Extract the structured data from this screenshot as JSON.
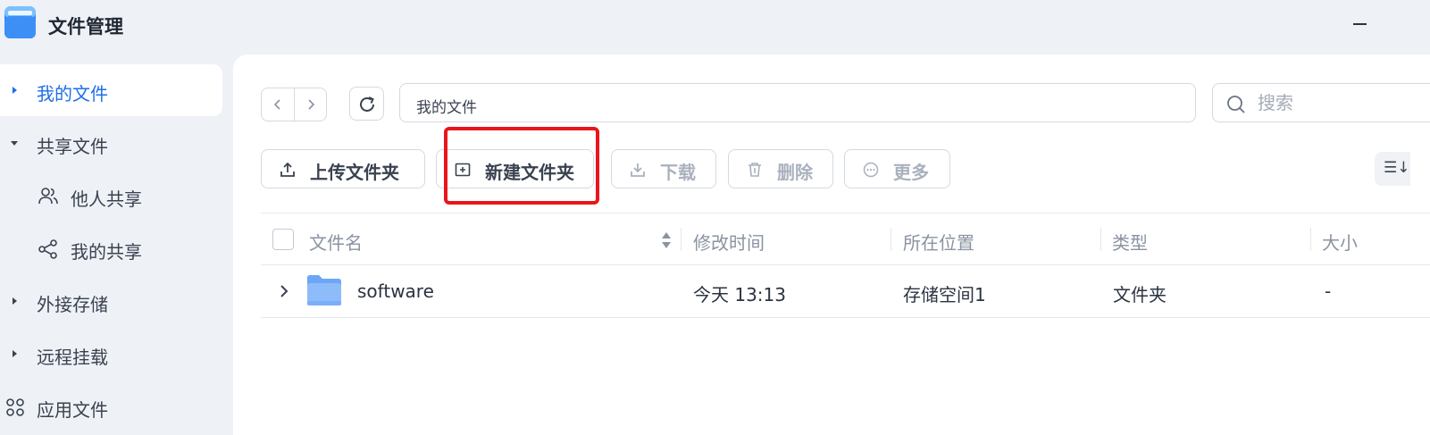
{
  "app": {
    "title": "文件管理",
    "icon": "folder-app-icon",
    "accent_color": "#1e6fe8"
  },
  "sidebar": {
    "items": [
      {
        "label": "我的文件",
        "active": true,
        "expanded": false
      },
      {
        "label": "共享文件",
        "active": false,
        "expanded": true
      },
      {
        "label": "他人共享",
        "icon": "users-icon",
        "sub": true
      },
      {
        "label": "我的共享",
        "icon": "share-icon",
        "sub": true
      },
      {
        "label": "外接存储",
        "active": false,
        "expanded": false
      },
      {
        "label": "远程挂载",
        "active": false,
        "expanded": false
      },
      {
        "label": "应用文件",
        "icon": "apps-grid-icon"
      }
    ]
  },
  "path_bar": {
    "path": "我的文件"
  },
  "search": {
    "placeholder": "搜索"
  },
  "toolbar": {
    "upload_label": "上传文件夹",
    "new_folder_label": "新建文件夹",
    "download_label": "下载",
    "delete_label": "删除",
    "more_label": "更多",
    "highlight_color": "#e8151a"
  },
  "table": {
    "columns": [
      "文件名",
      "修改时间",
      "所在位置",
      "类型",
      "大小"
    ],
    "rows": [
      {
        "name": "software",
        "modified": "今天 13:13",
        "location": "存储空间1",
        "type": "文件夹",
        "size": "-"
      }
    ]
  }
}
